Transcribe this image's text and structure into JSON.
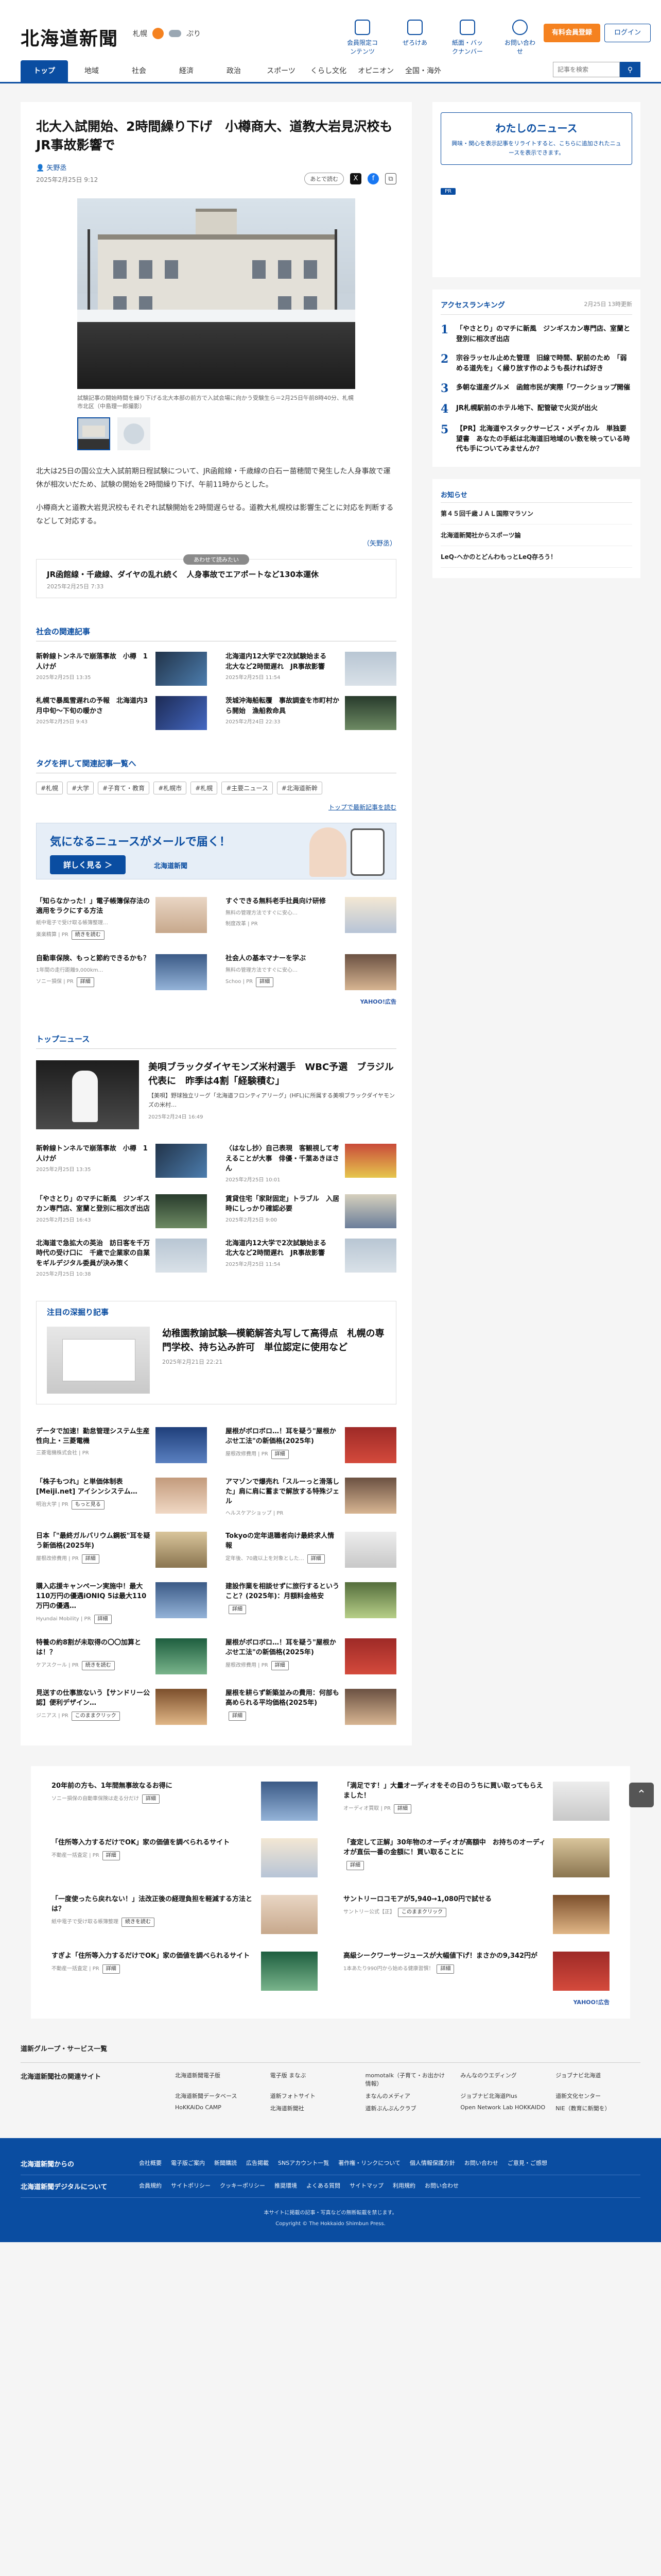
{
  "header": {
    "logo": "北海道新聞",
    "weather": {
      "city": "札幌",
      "label": "ぷり"
    },
    "icons": [
      {
        "label": "会員限定コンテンツ",
        "icon": "clock-icon"
      },
      {
        "label": "ぜろけあ",
        "icon": "tv-icon"
      },
      {
        "label": "紙面・バックナンバー",
        "icon": "newspaper-icon"
      },
      {
        "label": "お問い合わせ",
        "icon": "question-icon"
      }
    ],
    "member_button": "有料会員登録",
    "login_button": "ログイン"
  },
  "gnav": {
    "items": [
      "トップ",
      "地域",
      "社会",
      "経済",
      "政治",
      "スポーツ",
      "くらし文化",
      "オピニオン",
      "全国・海外"
    ],
    "active": 0,
    "search_placeholder": "記事を検索",
    "search_icon": "search-icon"
  },
  "article": {
    "title": "北大入試開始、2時間繰り下げ　小樽商大、道教大岩見沢校も　JR事故影響で",
    "byline": "矢野丞",
    "date": "2025年2月25日 9:12",
    "save_label": "あとで読む",
    "caption": "試験記事の開始時間を繰り下げる北大本部の前方で入試会場に向かう受験生ら＝2月25日午前8時40分、札幌市北区（中島理一郎撮影）",
    "paragraphs": [
      "北大は25日の国公立大入試前期日程試験について、JR函館線・千歳線の白石ー苗穂間で発生した人身事故で運休が相次いだため、試験の開始を2時間繰り下げ、午前11時からとした。",
      "小樽商大と道教大岩見沢校もそれぞれ試験開始を2時間遅らせる。道教大札幌校は影響生ごとに対応を判断するなどして対応する。"
    ],
    "credit": "（矢野丞）"
  },
  "pickup": {
    "tag": "あわせて読みたい",
    "title": "JR函館線・千歳線、ダイヤの乱れ続く　人身事故でエアポートなど130本運休",
    "date": "2025年2月25日 7:33"
  },
  "related": {
    "heading": "社会の関連記事",
    "items": [
      {
        "title": "新幹線トンネルで崩落事故　小樽　1人けが",
        "date": "2025年2月25日 13:35"
      },
      {
        "title": "北海道内12大学で2次試験始まる　北大など2時間遅れ　JR事故影響",
        "date": "2025年2月25日 11:54"
      },
      {
        "title": "札幌で暴風雪遅れの予報　北海道内3月中旬～下旬の暖かさ",
        "date": "2025年2月25日 9:43"
      },
      {
        "title": "茨城沖海船転覆　事故調査を市町村から開始　漁船救命具",
        "date": "2025年2月24日 22:33"
      }
    ]
  },
  "tags": {
    "heading": "タグを押して関連記事一覧へ",
    "list": [
      "#札幌",
      "#大学",
      "#子育て・教育",
      "#札幌市",
      "#札幌",
      "#主要ニュース",
      "#北海道新幹"
    ],
    "link": "トップで最新記事を読む"
  },
  "newsletter": {
    "title": "気になるニュースがメールで届く！",
    "button": "詳しく見る ＞",
    "brand": "北海道新聞",
    "phone_label": "道新"
  },
  "ads1": [
    {
      "title": "「知らなかった！」電子帳簿保存法の適用をラクにする方法",
      "source": "紙中電子で受け取る帳簿整理…",
      "sponsor": "楽楽精算 | PR",
      "btn": "続きを読む"
    },
    {
      "title": "すぐできる無料老手社員向け研修",
      "source": "無料の管理方法ですぐに安心…",
      "sponsor": "制度改革 | PR",
      "btn": ""
    },
    {
      "title": "自動車保険、もっと節約できるかも？",
      "source": "1年間の走行距離9,000km…",
      "sponsor": "ソニー損保 | PR",
      "btn": "詳細"
    },
    {
      "title": "社会人の基本マナーを学ぶ",
      "source": "無料の管理方法ですぐに安心…",
      "sponsor": "Schoo | PR",
      "btn": "詳細"
    }
  ],
  "yads": "YAHOO!広告",
  "top_news": {
    "heading": "トップニュース",
    "lead": {
      "title": "美唄ブラックダイヤモンズ米村選手　WBC予選　ブラジル代表に　昨季は4割「経験積む」",
      "summary": "【美唄】野球独立リーグ「北海道フロンティアリーグ」(HFL)に所属する美唄ブラックダイヤモンズの米村…",
      "date": "2025年2月24日 16:49"
    },
    "items": [
      {
        "title": "新幹線トンネルで崩落事故　小樽　1人けが",
        "date": "2025年2月25日 13:35"
      },
      {
        "title": "〈はなし抄〉自己表現　客観視して考えることが大事　俳優・千葉あきほさん",
        "date": "2025年2月25日 10:01"
      },
      {
        "title": "「やさとり」のマチに新風　ジンギスカン専門店、室蘭と登別に相次ぎ出店",
        "date": "2025年2月25日 16:43"
      },
      {
        "title": "賃貸住宅「家財固定」トラブル　入居時にしっかり確認必要",
        "date": "2025年2月25日 9:00"
      },
      {
        "title": "北海道で急拡大の英治　訪日客を千万時代の受け口に　千歳で企業家の自業をギルデジタル委員が決み策く",
        "date": "2025年2月25日 10:38"
      },
      {
        "title": "北海道内12大学で2次試験始まる　北大など2時間遅れ　JR事故影響",
        "date": "2025年2月25日 11:54"
      }
    ]
  },
  "deep": {
    "heading": "注目の深掘り記事",
    "title": "幼稚園教諭試験―模範解答丸写して高得点　札幌の専門学校、持ち込み許可　単位認定に使用など",
    "date": "2025年2月21日 22:21"
  },
  "ads2": [
    {
      "title": "データで加速！勤怠管理システム生産性向上・三菱電機",
      "sponsor": "三菱電機株式会社 | PR",
      "btn": ""
    },
    {
      "title": "屋根がボロボロ…！耳を疑う\"屋根かぶせ工法\"の新価格(2025年)",
      "sponsor": "屋根改修費用 | PR",
      "btn": "詳細"
    },
    {
      "title": "「株子もつれ」と単価体制表[Meiji.net] アイシンシステム…",
      "sponsor": "明治大学 | PR",
      "btn": "もっと見る"
    },
    {
      "title": "アマゾンで爆売れ「スルーっと滑落した」肩に肩に蓄まで解放する特殊ジェル",
      "sponsor": "ヘルスケアショップ | PR",
      "btn": ""
    },
    {
      "title": "日本「\"最終ガルバリウム鋼板\"耳を疑う新価格(2025年)",
      "sponsor": "屋根改修費用 | PR",
      "btn": "詳細"
    },
    {
      "title": "Tokyoの定年退職者向け最終求人情報",
      "sponsor": "定年後、70歳以上を対象とした…",
      "btn": "詳細"
    },
    {
      "title": "購入応援キャンペーン実施中！最大110万円の優遇iONIQ 5は最大110万円の優遇…",
      "sponsor": "Hyundai Mobility | PR",
      "btn": "詳細"
    },
    {
      "title": "建設作業を相談せずに旅行するということ？(2025年)：月額料金格安",
      "sponsor": "",
      "btn": "詳細"
    },
    {
      "title": "特養の約8割が未取得の〇〇加算とは！？",
      "sponsor": "ケアスクール | PR",
      "btn": "続きを読む"
    },
    {
      "title": "屋根がボロボロ…！耳を疑う\"屋根かぶせ工法\"の新価格(2025年)",
      "sponsor": "屋根改修費用 | PR",
      "btn": "詳細"
    },
    {
      "title": "見送すの仕事旅ないう【サンドリー公認】便利デザイン…",
      "sponsor": "ジニアス | PR",
      "btn": "このままクリック"
    },
    {
      "title": "屋根を耕らず新築並みの費用：何部も高められる平均価格(2025年)",
      "sponsor": "",
      "btn": "詳細"
    }
  ],
  "sidebar": {
    "mynews_title": "わたしのニュース",
    "mynews_text": "興味・関心を表示記事をリライトすると、こちらに追加されたニュースを表示できます。",
    "mynews_ad": "PR",
    "ranking_title": "アクセスランキング",
    "ranking_date": "2月25日 13時更新",
    "ranking": [
      "「やさとり」のマチに新風　ジンギスカン専門店、室蘭と登別に相次ぎ出店",
      "宗谷ラッセル止めた管理　旧線で時間、駅前のため　「弱める道先を」く縁り放す作のようも長ければ好き",
      "多朝な道産グルメ　函館市民が実際「ワークショップ開催",
      "JR札幌駅前のホテル地下、配管破で火災が出火",
      "【PR】北海道やスタックサービス・メディカル　単独要望書　あなたの手紙は北海道旧地域のい数を映っている時代も手についてみませんか？"
    ],
    "osusume_title": "お知らせ",
    "osusume": [
      "第４５回千歳ＪＡＬ国際マラソン",
      "北海道新聞社からスポーツ論",
      "LeQ-ヘかのとどんわもっとLeQ存ろう！"
    ]
  },
  "bottom_ads": [
    {
      "title": "20年前の方も、1年間無事故なるお得に",
      "sponsor": "ソニー損保の自動車保険は走る分だけ",
      "btn": "詳細"
    },
    {
      "title": "「満足です！」大量オーディオをその日のうちに買い取ってもらえました！",
      "sponsor": "オーディオ買取 | PR",
      "btn": "詳細"
    },
    {
      "title": "「住所等入力するだけでOK」家の価値を調べられるサイト",
      "sponsor": "不動産一括査定 | PR",
      "btn": "詳細"
    },
    {
      "title": "「査定して正解」30年物のオーディオが高額中　お持ちのオーディオが直伝一番の金額に！買い取ることに",
      "sponsor": "",
      "btn": "詳細"
    },
    {
      "title": "「一度使ったら戻れない！」法改正後の経理負担を軽減する方法とは？",
      "sponsor": "紙中電子で受け取る帳簿整理",
      "btn": "続きを読む"
    },
    {
      "title": "サントリーロコモアが5,940→1,080円で試せる",
      "sponsor": "サントリー公式【正】",
      "btn": "このままクリック"
    },
    {
      "title": "すぎよ「住所等入力するだけでOK」家の価値を調べられるサイト",
      "sponsor": "不動産一括査定 | PR",
      "btn": "詳細"
    },
    {
      "title": "高級シークワーサージュースが大幅値下げ！まさかの9,342円が",
      "sponsor": "1本あたり990円から始める健康習慣！",
      "btn": "詳細"
    }
  ],
  "group": {
    "heading": "道新グループ・サービス一覧",
    "name": "北海道新聞社の関連サイト",
    "links": [
      "北海道新聞電子版",
      "電子版 まなぶ",
      "momotalk（子育て・お出かけ情報）",
      "みんなのウエディング",
      "ジョブナビ北海道",
      "北海道新聞データベース",
      "道新フォトサイト",
      "まなんのメディア",
      "ジョブナビ北海道Plus",
      "道新文化センター",
      "HoKKAiDo CAMP",
      "北海道新聞社",
      "道新ぶんぶんクラブ",
      "Open Network Lab HOKKAIDO",
      "NIE（教育に新聞を）"
    ]
  },
  "footer": {
    "rows": [
      {
        "heading": "北海道新聞からの",
        "links": [
          "会社概要",
          "電子版ご案内",
          "新聞購読",
          "広告掲載",
          "SNSアカウント一覧",
          "著作権・リンクについて",
          "個人情報保護方針",
          "お問い合わせ",
          "ご意見・ご感想"
        ]
      },
      {
        "heading": "北海道新聞デジタルについて",
        "links": [
          "会員規約",
          "サイトポリシー",
          "クッキーポリシー",
          "推奨環境",
          "よくある質問",
          "サイトマップ",
          "利用規約",
          "お問い合わせ"
        ]
      }
    ],
    "note": "本サイトに掲載の記事・写真などの無断転載を禁じます。",
    "copyright": "Copyright © The Hokkaido Shimbun Press."
  }
}
